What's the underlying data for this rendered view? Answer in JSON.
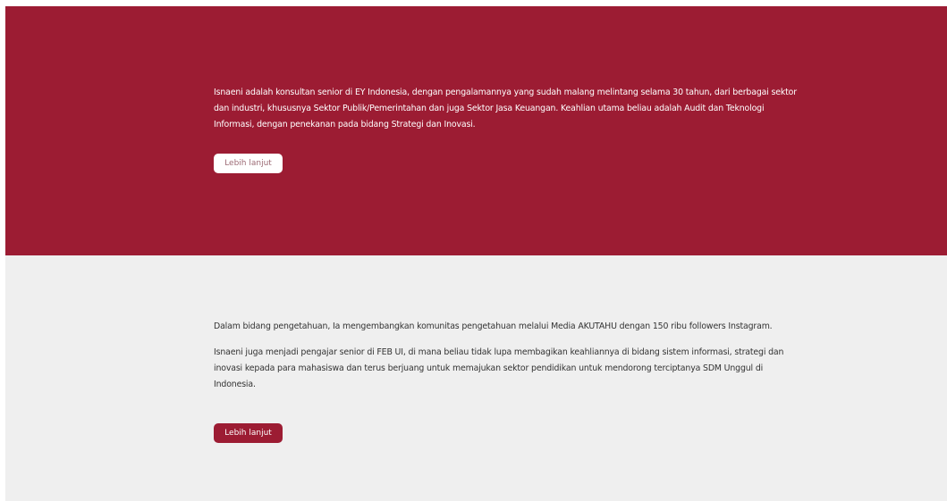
{
  "hero": {
    "paragraph": "Isnaeni adalah konsultan senior di EY Indonesia, dengan pengalamannya yang sudah malang melintang selama 30 tahun, dari berbagai sektor dan industri, khususnya Sektor Publik/Pemerintahan dan juga Sektor Jasa Keuangan. Keahlian utama beliau adalah Audit dan Teknologi Informasi, dengan penekanan pada bidang Strategi dan Inovasi.",
    "button_label": "Lebih lanjut"
  },
  "about": {
    "paragraph_1": "Dalam bidang pengetahuan, Ia mengembangkan komunitas pengetahuan melalui Media AKUTAHU dengan 150 ribu followers Instagram.",
    "paragraph_2": "Isnaeni juga menjadi pengajar senior di FEB UI, di mana beliau tidak lupa membagikan keahliannya di bidang sistem informasi, strategi dan inovasi kepada para mahasiswa dan terus berjuang untuk memajukan sektor pendidikan untuk mendorong terciptanya SDM Unggul di Indonesia.",
    "button_label": "Lebih lanjut"
  },
  "colors": {
    "brand_red": "#9c1c33",
    "section_grey": "#efefef"
  }
}
